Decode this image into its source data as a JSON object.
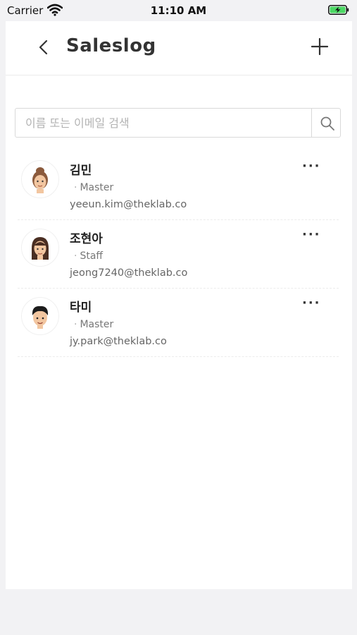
{
  "status_bar": {
    "carrier": "Carrier",
    "time": "11:10 AM"
  },
  "header": {
    "title": "Saleslog"
  },
  "search": {
    "placeholder": "이름 또는 이메일 검색",
    "value": ""
  },
  "members": [
    {
      "name": "김민",
      "role": "Master",
      "email": "yeeun.kim@theklab.co",
      "avatar": "female-avatar-brown-hair"
    },
    {
      "name": "조현아",
      "role": "Staff",
      "email": "jeong7240@theklab.co",
      "avatar": "female-avatar-long-hair"
    },
    {
      "name": "타미",
      "role": "Master",
      "email": "jy.park@theklab.co",
      "avatar": "male-avatar-black-hair"
    }
  ],
  "more_label": "···",
  "colors": {
    "background": "#f2f2f4",
    "card": "#ffffff",
    "battery": "#4cd964"
  }
}
